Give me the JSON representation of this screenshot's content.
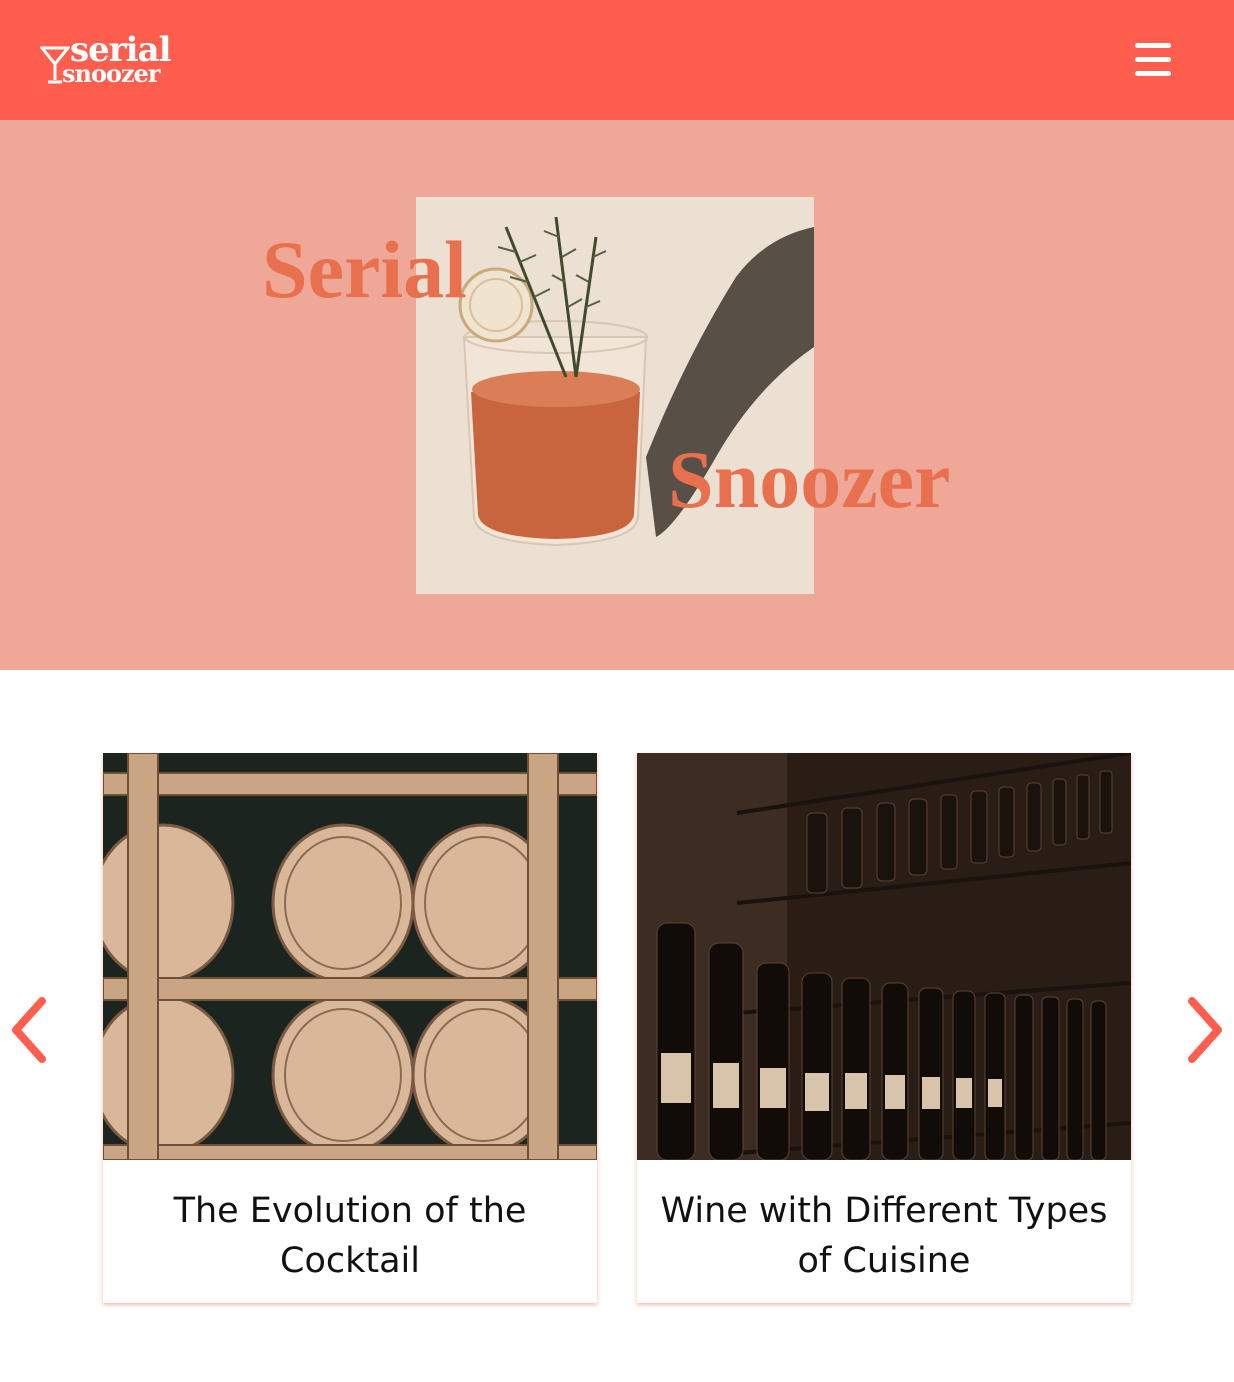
{
  "header": {
    "logo_line1": "serial",
    "logo_line2": "snoozer",
    "menu_icon": "hamburger-menu-icon",
    "background_color": "#ff5e4e"
  },
  "hero": {
    "title_word1": "Serial",
    "title_word2": "Snoozer",
    "title_color": "#e8704f",
    "background_color": "#efa897",
    "image_icon": "cocktail-glass-with-rosemary-and-citrus"
  },
  "carousel": {
    "prev_icon": "chevron-left-icon",
    "next_icon": "chevron-right-icon",
    "accent_color": "#ff5e4e",
    "cards": [
      {
        "title": "The Evolution of the Cocktail",
        "image_icon": "whiskey-barrels-photo"
      },
      {
        "title": "Wine with Different Types of Cuisine",
        "image_icon": "wine-bottle-shelves-photo"
      }
    ]
  }
}
